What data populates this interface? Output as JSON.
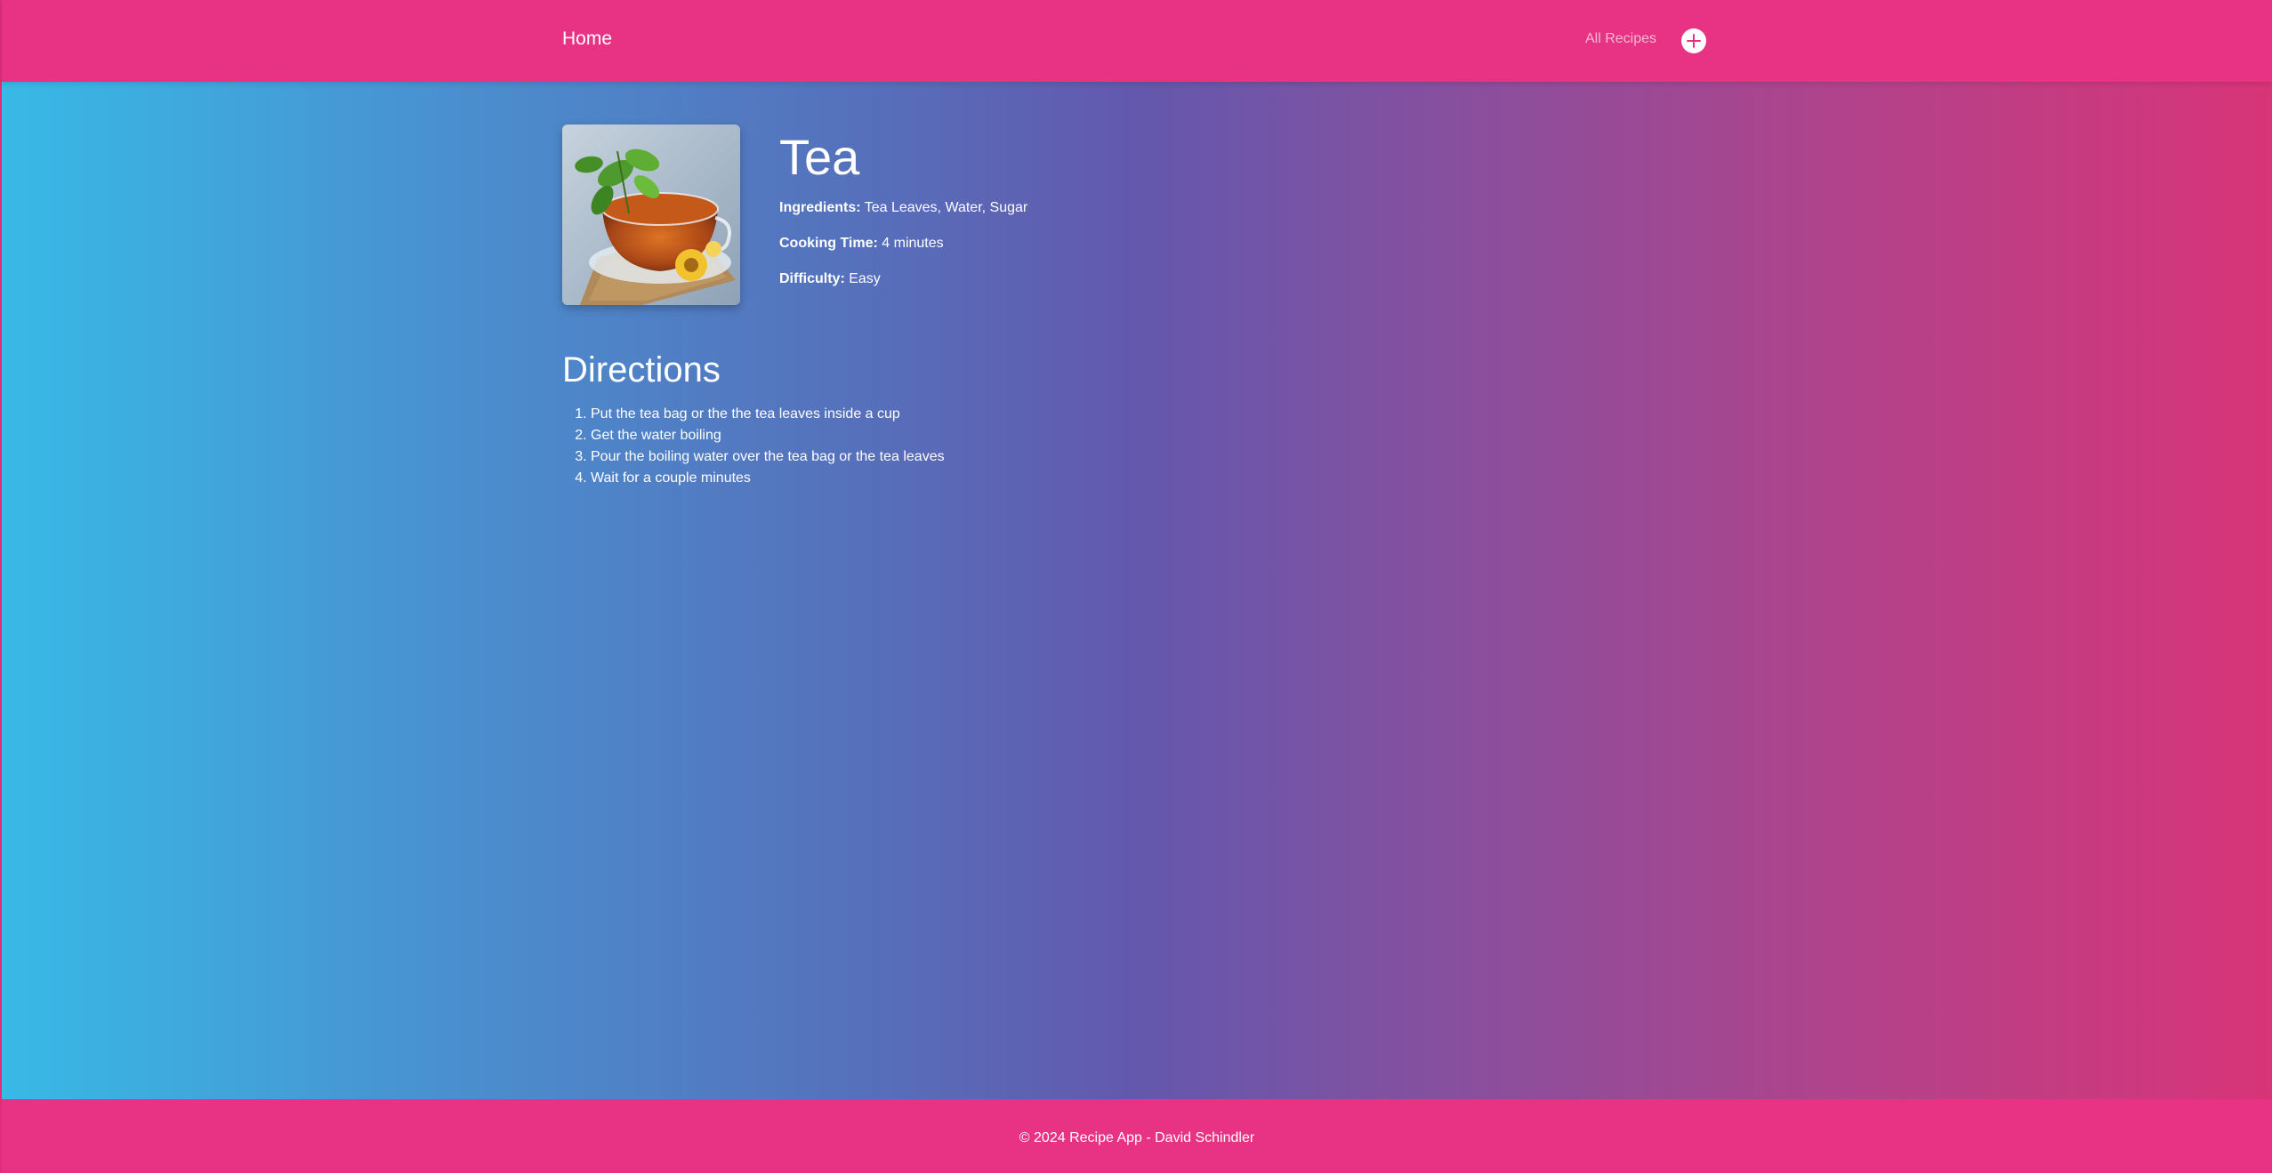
{
  "nav": {
    "home_label": "Home",
    "all_recipes_label": "All Recipes",
    "add_icon": "plus-circle-icon"
  },
  "recipe": {
    "title": "Tea",
    "image_icon": "tea-cup-photo",
    "ingredients_label": "Ingredients:",
    "ingredients_value": "Tea Leaves, Water, Sugar",
    "cooking_time_label": "Cooking Time:",
    "cooking_time_value": "4 minutes",
    "difficulty_label": "Difficulty:",
    "difficulty_value": "Easy"
  },
  "directions": {
    "heading": "Directions",
    "steps": [
      "Put the tea bag or the the tea leaves inside a cup",
      "Get the water boiling",
      "Pour the boiling water over the tea bag or the tea leaves",
      "Wait for a couple minutes"
    ]
  },
  "footer": {
    "text": "© 2024 Recipe App - David Schindler"
  },
  "colors": {
    "accent": "#e83283",
    "gradient_start": "#38b9e6",
    "gradient_end": "#d83478"
  }
}
